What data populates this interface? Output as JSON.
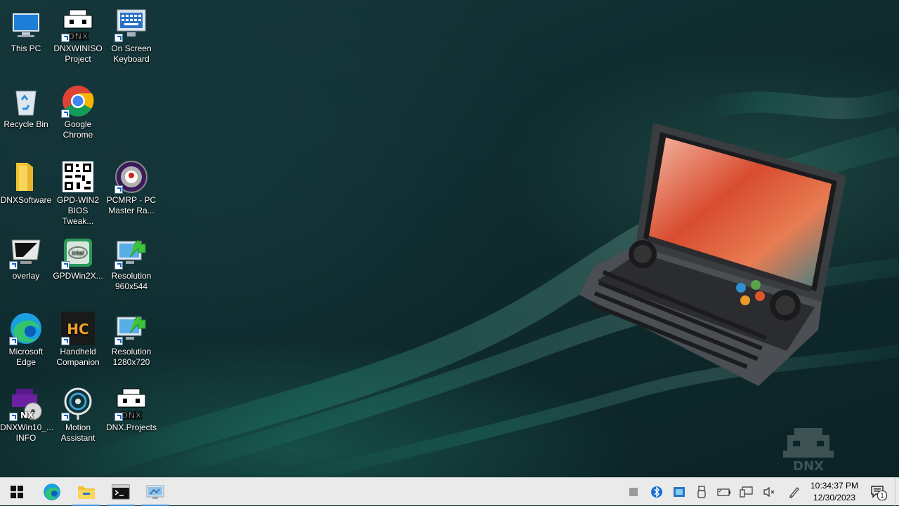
{
  "desktop": {
    "icons": [
      {
        "label": "This PC",
        "icon": "monitor-icon"
      },
      {
        "label": "DNXWINISO Project",
        "icon": "dnx-logo-icon"
      },
      {
        "label": "On Screen Keyboard",
        "icon": "keyboard-icon"
      },
      {
        "label": "Recycle Bin",
        "icon": "recycle-bin-icon"
      },
      {
        "label": "Google Chrome",
        "icon": "chrome-icon"
      },
      {
        "label": "DNXSoftware",
        "icon": "folder-icon"
      },
      {
        "label": "GPD-WIN2 BIOS Tweak...",
        "icon": "qr-code-icon"
      },
      {
        "label": "PCMRP - PC Master Ra...",
        "icon": "pcmr-logo-icon"
      },
      {
        "label": "overlay",
        "icon": "monitor-icon"
      },
      {
        "label": "GPDWin2X...",
        "icon": "intel-icon"
      },
      {
        "label": "Resolution 960x544",
        "icon": "resolution-icon"
      },
      {
        "label": "Microsoft Edge",
        "icon": "edge-icon"
      },
      {
        "label": "Handheld Companion",
        "icon": "hc-logo-icon"
      },
      {
        "label": "Resolution 1280x720",
        "icon": "resolution-icon"
      },
      {
        "label": "DNXWin10_... INFO",
        "icon": "dnx-disc-icon"
      },
      {
        "label": "Motion Assistant",
        "icon": "motion-icon"
      },
      {
        "label": "DNX.Projects",
        "icon": "dnx-logo-icon"
      }
    ],
    "watermark": "DNX"
  },
  "taskbar": {
    "pinned": [
      {
        "name": "start",
        "icon": "windows-logo-icon"
      },
      {
        "name": "edge",
        "icon": "edge-icon"
      },
      {
        "name": "file-explorer",
        "icon": "folder-icon"
      },
      {
        "name": "terminal",
        "icon": "terminal-icon"
      },
      {
        "name": "control-panel",
        "icon": "control-panel-icon"
      }
    ],
    "clock": {
      "time": "10:34:37 PM",
      "date": "12/30/2023"
    },
    "notifications_count": "1"
  },
  "colors": {
    "taskbar": "#eaeaea",
    "accent": "#3d8ee0",
    "wallpaper": "#0f2a2c"
  }
}
